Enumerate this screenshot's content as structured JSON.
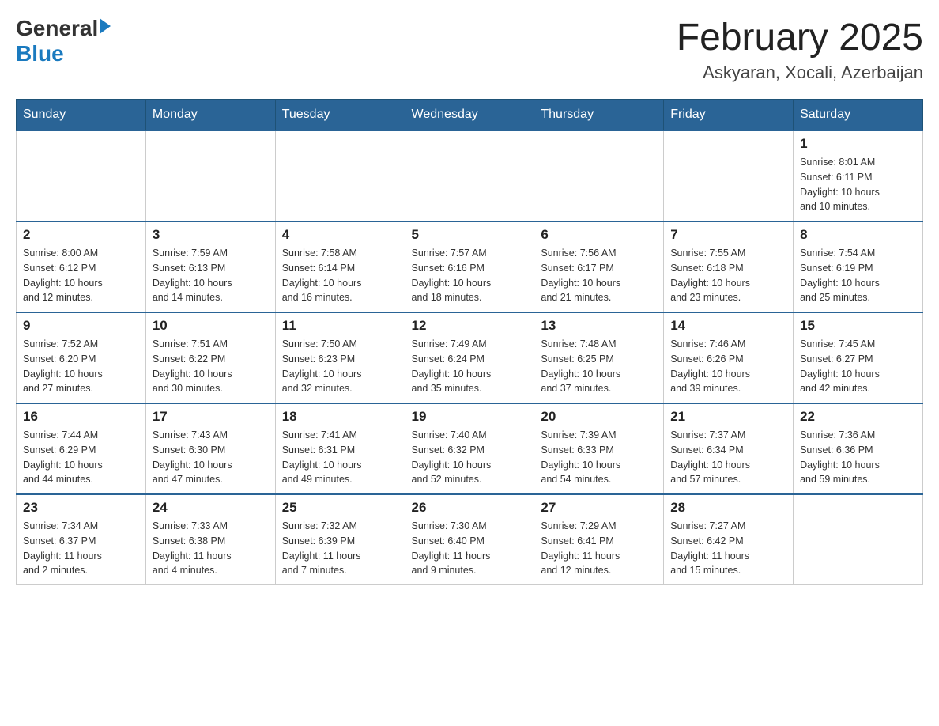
{
  "header": {
    "logo_general": "General",
    "logo_blue": "Blue",
    "month_year": "February 2025",
    "location": "Askyaran, Xocali, Azerbaijan"
  },
  "weekdays": [
    "Sunday",
    "Monday",
    "Tuesday",
    "Wednesday",
    "Thursday",
    "Friday",
    "Saturday"
  ],
  "rows": [
    [
      {
        "day": "",
        "info": ""
      },
      {
        "day": "",
        "info": ""
      },
      {
        "day": "",
        "info": ""
      },
      {
        "day": "",
        "info": ""
      },
      {
        "day": "",
        "info": ""
      },
      {
        "day": "",
        "info": ""
      },
      {
        "day": "1",
        "info": "Sunrise: 8:01 AM\nSunset: 6:11 PM\nDaylight: 10 hours\nand 10 minutes."
      }
    ],
    [
      {
        "day": "2",
        "info": "Sunrise: 8:00 AM\nSunset: 6:12 PM\nDaylight: 10 hours\nand 12 minutes."
      },
      {
        "day": "3",
        "info": "Sunrise: 7:59 AM\nSunset: 6:13 PM\nDaylight: 10 hours\nand 14 minutes."
      },
      {
        "day": "4",
        "info": "Sunrise: 7:58 AM\nSunset: 6:14 PM\nDaylight: 10 hours\nand 16 minutes."
      },
      {
        "day": "5",
        "info": "Sunrise: 7:57 AM\nSunset: 6:16 PM\nDaylight: 10 hours\nand 18 minutes."
      },
      {
        "day": "6",
        "info": "Sunrise: 7:56 AM\nSunset: 6:17 PM\nDaylight: 10 hours\nand 21 minutes."
      },
      {
        "day": "7",
        "info": "Sunrise: 7:55 AM\nSunset: 6:18 PM\nDaylight: 10 hours\nand 23 minutes."
      },
      {
        "day": "8",
        "info": "Sunrise: 7:54 AM\nSunset: 6:19 PM\nDaylight: 10 hours\nand 25 minutes."
      }
    ],
    [
      {
        "day": "9",
        "info": "Sunrise: 7:52 AM\nSunset: 6:20 PM\nDaylight: 10 hours\nand 27 minutes."
      },
      {
        "day": "10",
        "info": "Sunrise: 7:51 AM\nSunset: 6:22 PM\nDaylight: 10 hours\nand 30 minutes."
      },
      {
        "day": "11",
        "info": "Sunrise: 7:50 AM\nSunset: 6:23 PM\nDaylight: 10 hours\nand 32 minutes."
      },
      {
        "day": "12",
        "info": "Sunrise: 7:49 AM\nSunset: 6:24 PM\nDaylight: 10 hours\nand 35 minutes."
      },
      {
        "day": "13",
        "info": "Sunrise: 7:48 AM\nSunset: 6:25 PM\nDaylight: 10 hours\nand 37 minutes."
      },
      {
        "day": "14",
        "info": "Sunrise: 7:46 AM\nSunset: 6:26 PM\nDaylight: 10 hours\nand 39 minutes."
      },
      {
        "day": "15",
        "info": "Sunrise: 7:45 AM\nSunset: 6:27 PM\nDaylight: 10 hours\nand 42 minutes."
      }
    ],
    [
      {
        "day": "16",
        "info": "Sunrise: 7:44 AM\nSunset: 6:29 PM\nDaylight: 10 hours\nand 44 minutes."
      },
      {
        "day": "17",
        "info": "Sunrise: 7:43 AM\nSunset: 6:30 PM\nDaylight: 10 hours\nand 47 minutes."
      },
      {
        "day": "18",
        "info": "Sunrise: 7:41 AM\nSunset: 6:31 PM\nDaylight: 10 hours\nand 49 minutes."
      },
      {
        "day": "19",
        "info": "Sunrise: 7:40 AM\nSunset: 6:32 PM\nDaylight: 10 hours\nand 52 minutes."
      },
      {
        "day": "20",
        "info": "Sunrise: 7:39 AM\nSunset: 6:33 PM\nDaylight: 10 hours\nand 54 minutes."
      },
      {
        "day": "21",
        "info": "Sunrise: 7:37 AM\nSunset: 6:34 PM\nDaylight: 10 hours\nand 57 minutes."
      },
      {
        "day": "22",
        "info": "Sunrise: 7:36 AM\nSunset: 6:36 PM\nDaylight: 10 hours\nand 59 minutes."
      }
    ],
    [
      {
        "day": "23",
        "info": "Sunrise: 7:34 AM\nSunset: 6:37 PM\nDaylight: 11 hours\nand 2 minutes."
      },
      {
        "day": "24",
        "info": "Sunrise: 7:33 AM\nSunset: 6:38 PM\nDaylight: 11 hours\nand 4 minutes."
      },
      {
        "day": "25",
        "info": "Sunrise: 7:32 AM\nSunset: 6:39 PM\nDaylight: 11 hours\nand 7 minutes."
      },
      {
        "day": "26",
        "info": "Sunrise: 7:30 AM\nSunset: 6:40 PM\nDaylight: 11 hours\nand 9 minutes."
      },
      {
        "day": "27",
        "info": "Sunrise: 7:29 AM\nSunset: 6:41 PM\nDaylight: 11 hours\nand 12 minutes."
      },
      {
        "day": "28",
        "info": "Sunrise: 7:27 AM\nSunset: 6:42 PM\nDaylight: 11 hours\nand 15 minutes."
      },
      {
        "day": "",
        "info": ""
      }
    ]
  ]
}
